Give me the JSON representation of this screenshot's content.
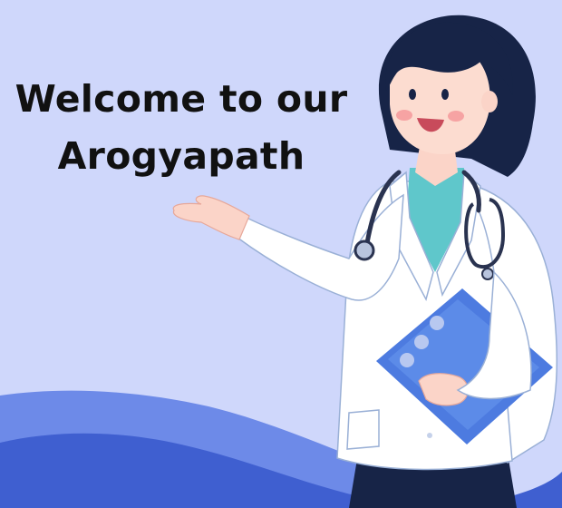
{
  "welcome": {
    "line1": "Welcome to our",
    "line2": "Arogyapath"
  },
  "colors": {
    "background": "#cfd7fb",
    "wave_light": "#6d8ae8",
    "wave_dark": "#3f5fd0",
    "hair": "#172447",
    "coat": "#ffffff",
    "scrubs": "#5fc7cb",
    "clipboard": "#4d7be0"
  },
  "illustration": {
    "subject": "doctor-woman-with-stethoscope-and-clipboard"
  }
}
